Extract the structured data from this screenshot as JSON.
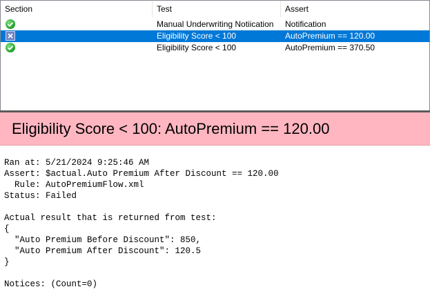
{
  "list": {
    "columns": {
      "section": "Section",
      "test": "Test",
      "assert": "Assert"
    },
    "rows": [
      {
        "status": "pass",
        "icon": "check-circle-icon",
        "test": "Manual Underwriting Notiication",
        "assert": "Notification",
        "selected": false
      },
      {
        "status": "fail",
        "icon": "fail-x-icon",
        "test": "Eligibility Score < 100",
        "assert": "AutoPremium == 120.00",
        "selected": true
      },
      {
        "status": "pass",
        "icon": "check-circle-icon",
        "test": "Eligibility Score < 100",
        "assert": "AutoPremium == 370.50",
        "selected": false
      }
    ]
  },
  "banner": {
    "title": "Eligibility Score < 100: AutoPremium == 120.00",
    "color": "#ffb6c1"
  },
  "details": {
    "lines": [
      "Ran at: 5/21/2024 9:25:46 AM",
      "Assert: $actual.Auto Premium After Discount == 120.00",
      "  Rule: AutoPremiumFlow.xml",
      "Status: Failed",
      "",
      "Actual result that is returned from test:",
      "{",
      "  \"Auto Premium Before Discount\": 850,",
      "  \"Auto Premium After Discount\": 120.5",
      "}",
      "",
      "Notices: (Count=0)"
    ]
  },
  "colors": {
    "selection": "#0078d7",
    "pass": "#1f9e2a",
    "fail": "#6f86c6",
    "splitter": "#5a5a5a"
  }
}
